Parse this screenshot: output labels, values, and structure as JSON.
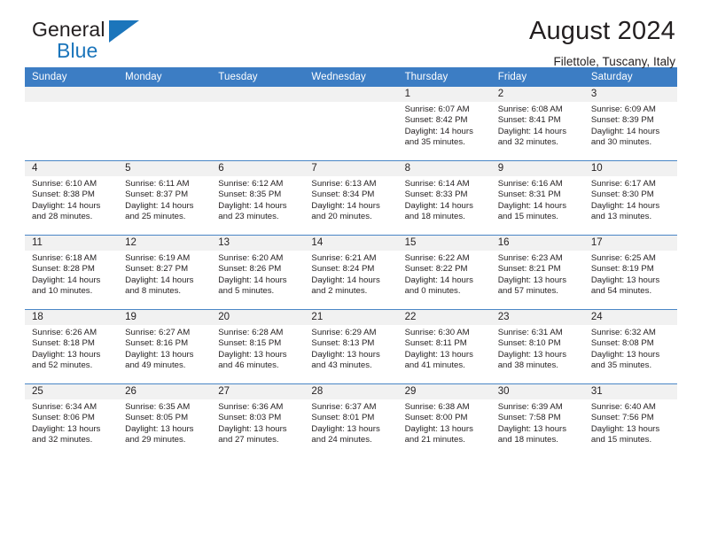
{
  "brand": {
    "word1": "General",
    "word2": "Blue",
    "logo_icon": "triangle-logo-icon",
    "accent_color": "#1b75bb"
  },
  "header": {
    "month_title": "August 2024",
    "location": "Filettole, Tuscany, Italy"
  },
  "theme": {
    "header_row_bg": "#3c7dc4",
    "daynum_band_bg": "#f1f1f1",
    "grid_line": "#4a86c6",
    "text": "#231f20"
  },
  "weekdays": [
    "Sunday",
    "Monday",
    "Tuesday",
    "Wednesday",
    "Thursday",
    "Friday",
    "Saturday"
  ],
  "weeks": [
    [
      {
        "day": "",
        "empty": true
      },
      {
        "day": "",
        "empty": true
      },
      {
        "day": "",
        "empty": true
      },
      {
        "day": "",
        "empty": true
      },
      {
        "day": "1",
        "sunrise": "Sunrise: 6:07 AM",
        "sunset": "Sunset: 8:42 PM",
        "daylight1": "Daylight: 14 hours",
        "daylight2": "and 35 minutes."
      },
      {
        "day": "2",
        "sunrise": "Sunrise: 6:08 AM",
        "sunset": "Sunset: 8:41 PM",
        "daylight1": "Daylight: 14 hours",
        "daylight2": "and 32 minutes."
      },
      {
        "day": "3",
        "sunrise": "Sunrise: 6:09 AM",
        "sunset": "Sunset: 8:39 PM",
        "daylight1": "Daylight: 14 hours",
        "daylight2": "and 30 minutes."
      }
    ],
    [
      {
        "day": "4",
        "sunrise": "Sunrise: 6:10 AM",
        "sunset": "Sunset: 8:38 PM",
        "daylight1": "Daylight: 14 hours",
        "daylight2": "and 28 minutes."
      },
      {
        "day": "5",
        "sunrise": "Sunrise: 6:11 AM",
        "sunset": "Sunset: 8:37 PM",
        "daylight1": "Daylight: 14 hours",
        "daylight2": "and 25 minutes."
      },
      {
        "day": "6",
        "sunrise": "Sunrise: 6:12 AM",
        "sunset": "Sunset: 8:35 PM",
        "daylight1": "Daylight: 14 hours",
        "daylight2": "and 23 minutes."
      },
      {
        "day": "7",
        "sunrise": "Sunrise: 6:13 AM",
        "sunset": "Sunset: 8:34 PM",
        "daylight1": "Daylight: 14 hours",
        "daylight2": "and 20 minutes."
      },
      {
        "day": "8",
        "sunrise": "Sunrise: 6:14 AM",
        "sunset": "Sunset: 8:33 PM",
        "daylight1": "Daylight: 14 hours",
        "daylight2": "and 18 minutes."
      },
      {
        "day": "9",
        "sunrise": "Sunrise: 6:16 AM",
        "sunset": "Sunset: 8:31 PM",
        "daylight1": "Daylight: 14 hours",
        "daylight2": "and 15 minutes."
      },
      {
        "day": "10",
        "sunrise": "Sunrise: 6:17 AM",
        "sunset": "Sunset: 8:30 PM",
        "daylight1": "Daylight: 14 hours",
        "daylight2": "and 13 minutes."
      }
    ],
    [
      {
        "day": "11",
        "sunrise": "Sunrise: 6:18 AM",
        "sunset": "Sunset: 8:28 PM",
        "daylight1": "Daylight: 14 hours",
        "daylight2": "and 10 minutes."
      },
      {
        "day": "12",
        "sunrise": "Sunrise: 6:19 AM",
        "sunset": "Sunset: 8:27 PM",
        "daylight1": "Daylight: 14 hours",
        "daylight2": "and 8 minutes."
      },
      {
        "day": "13",
        "sunrise": "Sunrise: 6:20 AM",
        "sunset": "Sunset: 8:26 PM",
        "daylight1": "Daylight: 14 hours",
        "daylight2": "and 5 minutes."
      },
      {
        "day": "14",
        "sunrise": "Sunrise: 6:21 AM",
        "sunset": "Sunset: 8:24 PM",
        "daylight1": "Daylight: 14 hours",
        "daylight2": "and 2 minutes."
      },
      {
        "day": "15",
        "sunrise": "Sunrise: 6:22 AM",
        "sunset": "Sunset: 8:22 PM",
        "daylight1": "Daylight: 14 hours",
        "daylight2": "and 0 minutes."
      },
      {
        "day": "16",
        "sunrise": "Sunrise: 6:23 AM",
        "sunset": "Sunset: 8:21 PM",
        "daylight1": "Daylight: 13 hours",
        "daylight2": "and 57 minutes."
      },
      {
        "day": "17",
        "sunrise": "Sunrise: 6:25 AM",
        "sunset": "Sunset: 8:19 PM",
        "daylight1": "Daylight: 13 hours",
        "daylight2": "and 54 minutes."
      }
    ],
    [
      {
        "day": "18",
        "sunrise": "Sunrise: 6:26 AM",
        "sunset": "Sunset: 8:18 PM",
        "daylight1": "Daylight: 13 hours",
        "daylight2": "and 52 minutes."
      },
      {
        "day": "19",
        "sunrise": "Sunrise: 6:27 AM",
        "sunset": "Sunset: 8:16 PM",
        "daylight1": "Daylight: 13 hours",
        "daylight2": "and 49 minutes."
      },
      {
        "day": "20",
        "sunrise": "Sunrise: 6:28 AM",
        "sunset": "Sunset: 8:15 PM",
        "daylight1": "Daylight: 13 hours",
        "daylight2": "and 46 minutes."
      },
      {
        "day": "21",
        "sunrise": "Sunrise: 6:29 AM",
        "sunset": "Sunset: 8:13 PM",
        "daylight1": "Daylight: 13 hours",
        "daylight2": "and 43 minutes."
      },
      {
        "day": "22",
        "sunrise": "Sunrise: 6:30 AM",
        "sunset": "Sunset: 8:11 PM",
        "daylight1": "Daylight: 13 hours",
        "daylight2": "and 41 minutes."
      },
      {
        "day": "23",
        "sunrise": "Sunrise: 6:31 AM",
        "sunset": "Sunset: 8:10 PM",
        "daylight1": "Daylight: 13 hours",
        "daylight2": "and 38 minutes."
      },
      {
        "day": "24",
        "sunrise": "Sunrise: 6:32 AM",
        "sunset": "Sunset: 8:08 PM",
        "daylight1": "Daylight: 13 hours",
        "daylight2": "and 35 minutes."
      }
    ],
    [
      {
        "day": "25",
        "sunrise": "Sunrise: 6:34 AM",
        "sunset": "Sunset: 8:06 PM",
        "daylight1": "Daylight: 13 hours",
        "daylight2": "and 32 minutes."
      },
      {
        "day": "26",
        "sunrise": "Sunrise: 6:35 AM",
        "sunset": "Sunset: 8:05 PM",
        "daylight1": "Daylight: 13 hours",
        "daylight2": "and 29 minutes."
      },
      {
        "day": "27",
        "sunrise": "Sunrise: 6:36 AM",
        "sunset": "Sunset: 8:03 PM",
        "daylight1": "Daylight: 13 hours",
        "daylight2": "and 27 minutes."
      },
      {
        "day": "28",
        "sunrise": "Sunrise: 6:37 AM",
        "sunset": "Sunset: 8:01 PM",
        "daylight1": "Daylight: 13 hours",
        "daylight2": "and 24 minutes."
      },
      {
        "day": "29",
        "sunrise": "Sunrise: 6:38 AM",
        "sunset": "Sunset: 8:00 PM",
        "daylight1": "Daylight: 13 hours",
        "daylight2": "and 21 minutes."
      },
      {
        "day": "30",
        "sunrise": "Sunrise: 6:39 AM",
        "sunset": "Sunset: 7:58 PM",
        "daylight1": "Daylight: 13 hours",
        "daylight2": "and 18 minutes."
      },
      {
        "day": "31",
        "sunrise": "Sunrise: 6:40 AM",
        "sunset": "Sunset: 7:56 PM",
        "daylight1": "Daylight: 13 hours",
        "daylight2": "and 15 minutes."
      }
    ]
  ]
}
